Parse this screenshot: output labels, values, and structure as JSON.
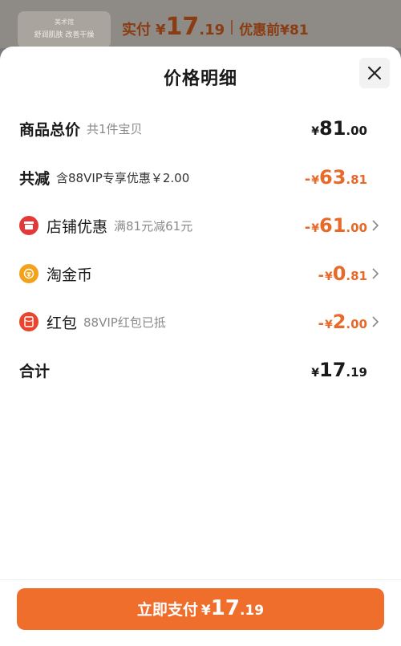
{
  "backdrop": {
    "thumb_text_1": "美术馆",
    "thumb_text_2": "舒润肌肤 改善干燥",
    "pay_label": "实付",
    "currency": "¥",
    "pay_int": "17",
    "pay_dec": ".19",
    "before_label": "优惠前¥81"
  },
  "sheet": {
    "title": "价格明细",
    "close_icon": "close-icon"
  },
  "rows": {
    "total": {
      "label": "商品总价",
      "sub": "共1件宝贝",
      "sign": "",
      "yen": "¥",
      "int": "81",
      "dec": ".00"
    },
    "discount": {
      "label": "共减",
      "sub": "含88VIP专享优惠￥2.00",
      "sign": "-",
      "yen": "¥",
      "int": "63",
      "dec": ".81"
    },
    "store": {
      "label": "店铺优惠",
      "sub": "满81元减61元",
      "sign": "-",
      "yen": "¥",
      "int": "61",
      "dec": ".00",
      "icon": "store-icon",
      "icon_color": "#e23a3a"
    },
    "coins": {
      "label": "淘金币",
      "sub": "",
      "sign": "-",
      "yen": "¥",
      "int": "0",
      "dec": ".81",
      "icon": "coin-icon",
      "icon_color": "#f3a21b"
    },
    "redpacket": {
      "label": "红包",
      "sub": "88VIP红包已抵",
      "sign": "-",
      "yen": "¥",
      "int": "2",
      "dec": ".00",
      "icon": "red-packet-icon",
      "icon_color": "#e8442e"
    },
    "sum": {
      "label": "合计",
      "sign": "",
      "yen": "¥",
      "int": "17",
      "dec": ".19"
    }
  },
  "pay_button": {
    "label": "立即支付",
    "yen": "¥",
    "int": "17",
    "dec": ".19"
  },
  "colors": {
    "accent": "#ef6e2c",
    "discount_text": "#e86a2a"
  }
}
